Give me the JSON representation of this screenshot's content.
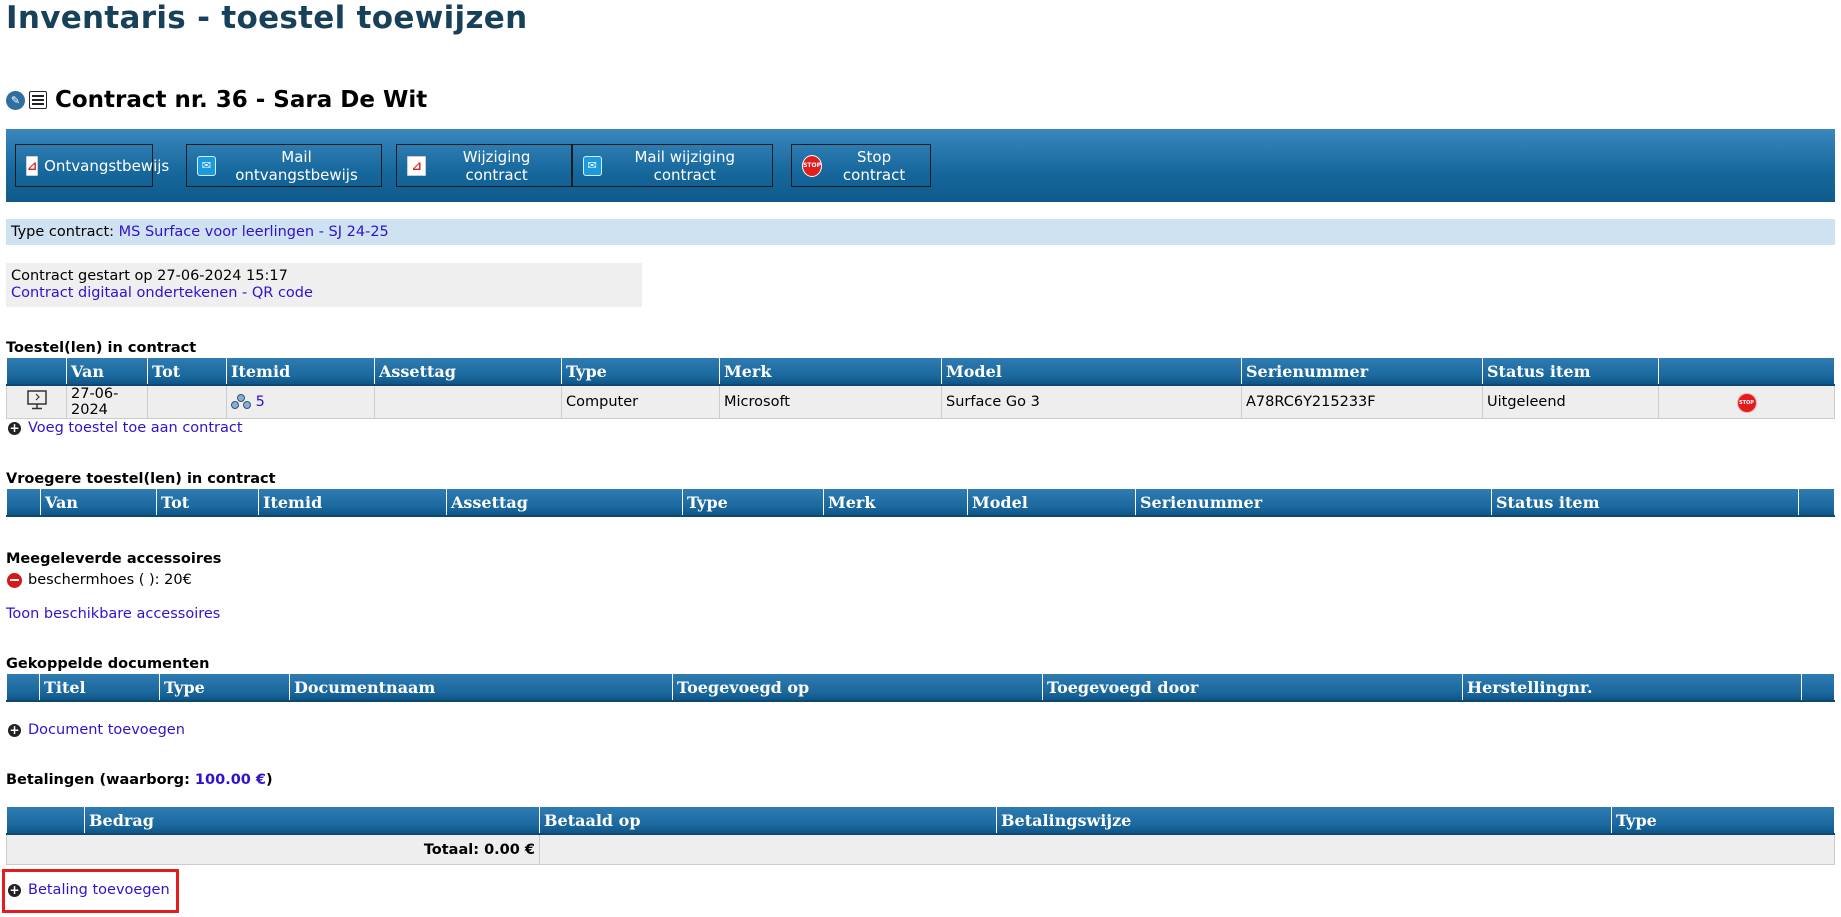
{
  "page_title": "Inventaris - toestel toewijzen",
  "contract": {
    "title": "Contract nr. 36 - Sara De Wit"
  },
  "toolbar": {
    "buttons": [
      {
        "label": "Ontvangstbewijs",
        "icon": "pdf-icon"
      },
      {
        "label": "Mail ontvangstbewijs",
        "icon": "mail-icon"
      },
      {
        "label": "Wijziging contract",
        "icon": "pdf-icon"
      },
      {
        "label": "Mail wijziging contract",
        "icon": "mail-icon"
      },
      {
        "label": "Stop contract",
        "icon": "stop-icon"
      }
    ],
    "stop_icon_text": "STOP",
    "pdf_icon_text": "⌂"
  },
  "type_contract": {
    "label": "Type contract:",
    "value": "MS Surface voor leerlingen - SJ 24-25"
  },
  "start": {
    "text": "Contract gestart op 27-06-2024 15:17",
    "link_sign": "Contract digitaal ondertekenen",
    "separator": "-",
    "link_qr": "QR code"
  },
  "devices": {
    "title": "Toestel(len) in contract",
    "columns": [
      "Van",
      "Tot",
      "Itemid",
      "Assettag",
      "Type",
      "Merk",
      "Model",
      "Serienummer",
      "Status item"
    ],
    "rows": [
      {
        "van": "27-06-2024",
        "tot": "",
        "itemid": "5",
        "assettag": "",
        "type": "Computer",
        "merk": "Microsoft",
        "model": "Surface Go 3",
        "serienummer": "A78RC6Y215233F",
        "status": "Uitgeleend"
      }
    ],
    "add_link": "Voeg toestel toe aan contract"
  },
  "previous_devices": {
    "title": "Vroegere toestel(len) in contract",
    "columns": [
      "Van",
      "Tot",
      "Itemid",
      "Assettag",
      "Type",
      "Merk",
      "Model",
      "Serienummer",
      "Status item"
    ]
  },
  "accessories": {
    "title": "Meegeleverde accessoires",
    "items": [
      {
        "text": "beschermhoes ( ): 20€"
      }
    ],
    "show_link": "Toon beschikbare accessoires"
  },
  "documents": {
    "title": "Gekoppelde documenten",
    "columns": [
      "Titel",
      "Type",
      "Documentnaam",
      "Toegevoegd op",
      "Toegevoegd door",
      "Herstellingnr."
    ],
    "add_link": "Document toevoegen"
  },
  "payments": {
    "title_prefix": "Betalingen (waarborg: ",
    "deposit": "100.00 €",
    "title_suffix": ")",
    "columns": [
      "Bedrag",
      "Betaald op",
      "Betalingswijze",
      "Type"
    ],
    "total": "Totaal: 0.00 €",
    "add_link": "Betaling toevoegen"
  },
  "colors": {
    "accent": "#17405a",
    "link": "#3311cc",
    "header_blue": "#1a689e",
    "highlight": "#e41c1c"
  }
}
